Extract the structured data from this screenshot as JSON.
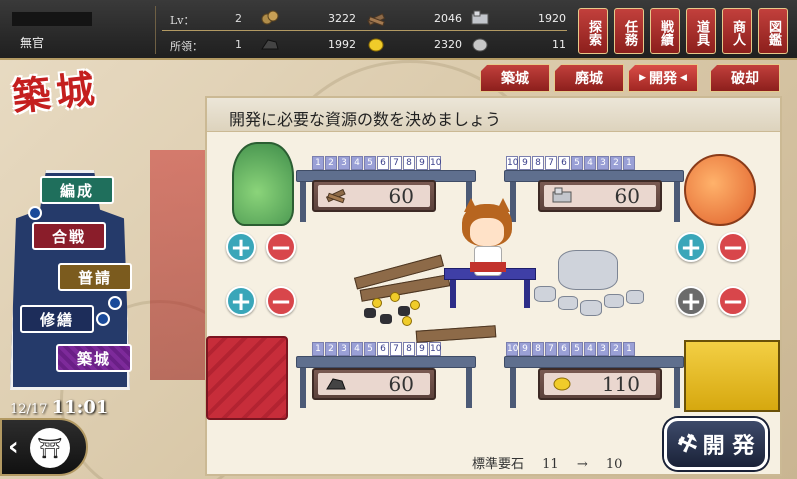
{
  "header": {
    "rank": "無官",
    "lv_label": "Lv：",
    "lv_value": "2",
    "territory_label": "所領：",
    "territory_value": "1"
  },
  "resources": [
    {
      "icon": "charcoal-icon",
      "value": "3222",
      "color": "#b08d4a"
    },
    {
      "icon": "lumber-icon",
      "value": "2046",
      "color": "#8d6a48"
    },
    {
      "icon": "stone-icon",
      "value": "1920",
      "color": "#c3c6cc"
    },
    {
      "icon": "iron-ore-icon",
      "value": "1992",
      "color": "#444"
    },
    {
      "icon": "gold-icon",
      "value": "2320",
      "color": "#f0cc2a"
    },
    {
      "icon": "rice-bale-icon",
      "value": "11",
      "color": "#c8c8c8"
    }
  ],
  "top_menu": [
    "探索",
    "任務",
    "戦績",
    "道具",
    "商人",
    "図鑑"
  ],
  "page_title": "築城",
  "sub_tabs": [
    "築城",
    "廃城",
    "開発",
    "破却"
  ],
  "active_sub_tab": "開発",
  "castle_nav": [
    "編成",
    "合戦",
    "普請",
    "修繕",
    "築城"
  ],
  "clock": {
    "date": "12/17",
    "time": "11:01"
  },
  "panel": {
    "instruction": "開発に必要な資源の数を決めましょう",
    "quadrants": [
      {
        "id": "top-left",
        "resource": "lumber",
        "value": "60",
        "scale": [
          "1",
          "2",
          "3",
          "4",
          "5",
          "6",
          "7",
          "8",
          "9",
          "10"
        ],
        "level": 5
      },
      {
        "id": "top-right",
        "resource": "stone",
        "value": "60",
        "scale": [
          "10",
          "9",
          "8",
          "7",
          "6",
          "5",
          "4",
          "3",
          "2",
          "1"
        ],
        "level": 5
      },
      {
        "id": "bottom-left",
        "resource": "iron",
        "value": "60",
        "scale": [
          "1",
          "2",
          "3",
          "4",
          "5",
          "6",
          "7",
          "8",
          "9",
          "10"
        ],
        "level": 5
      },
      {
        "id": "bottom-right",
        "resource": "gold",
        "value": "110",
        "scale": [
          "10",
          "9",
          "8",
          "7",
          "6",
          "5",
          "4",
          "3",
          "2",
          "1"
        ],
        "level": 10
      }
    ],
    "footer": {
      "label": "標準要石",
      "from": "11",
      "arrow": "→",
      "to": "10"
    },
    "develop_button": "開 発"
  },
  "colors": {
    "accent_red": "#c2403c",
    "panel_bg": "#f6f0e2",
    "plus": "#3aa6b9",
    "minus": "#d8464b"
  }
}
